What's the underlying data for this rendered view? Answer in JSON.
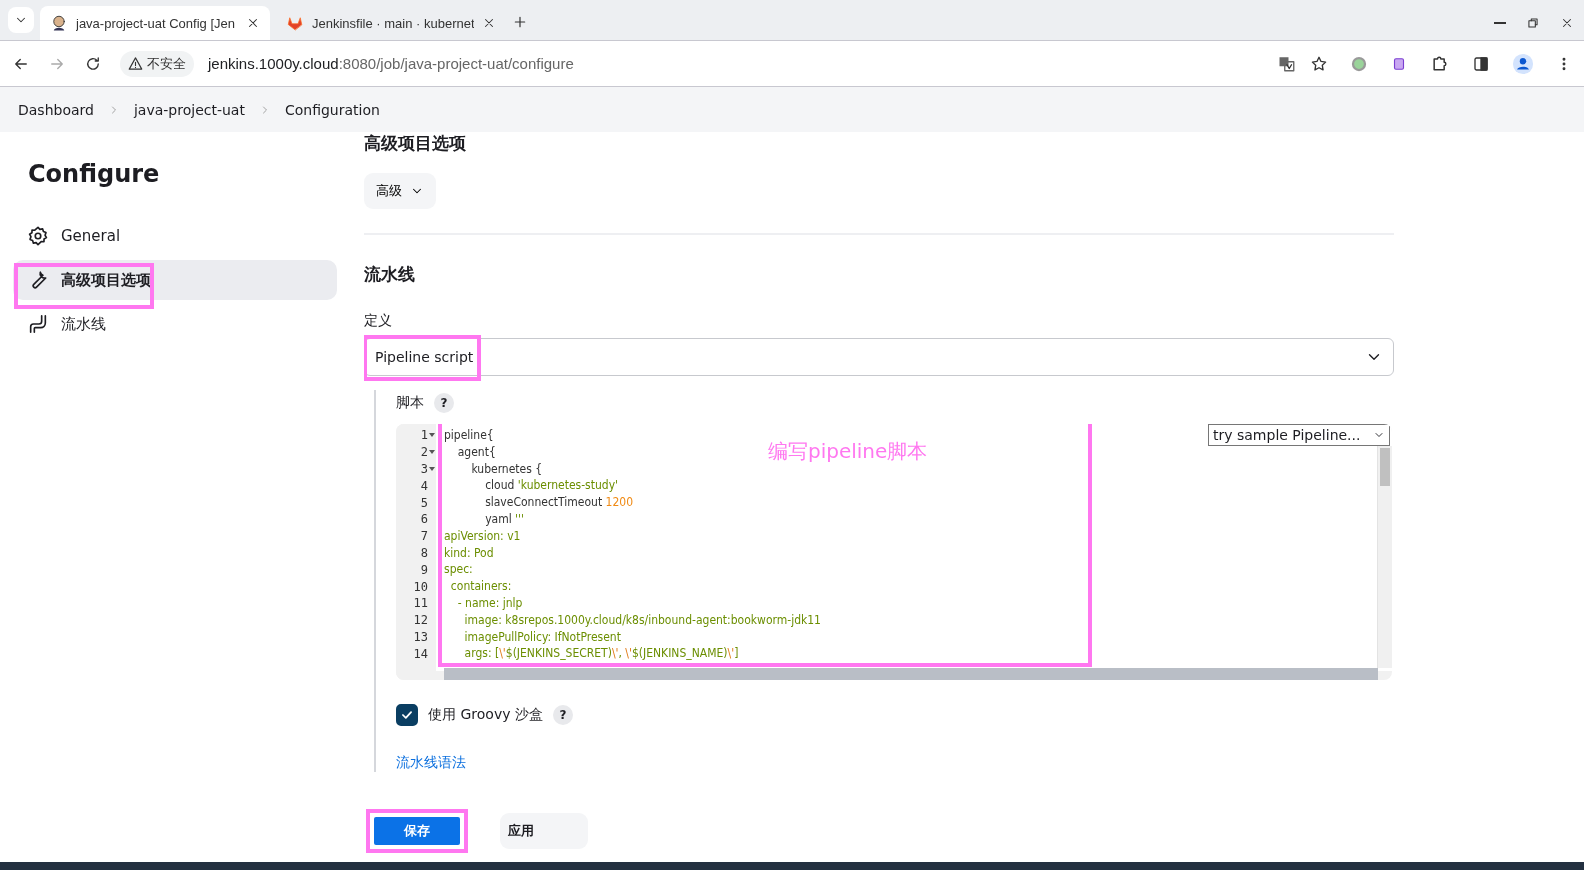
{
  "browser": {
    "tabs": [
      {
        "title": "java-project-uat Config [Jen",
        "selected": true
      },
      {
        "title": "Jenkinsfile · main · kubernet",
        "selected": false
      }
    ],
    "security": "不安全",
    "url_host": "jenkins.1000y.cloud",
    "url_path": ":8080/job/java-project-uat/configure"
  },
  "breadcrumbs": [
    "Dashboard",
    "java-project-uat",
    "Configuration"
  ],
  "sidebar": {
    "title": "Configure",
    "items": [
      {
        "label": "General",
        "selected": false
      },
      {
        "label": "高级项目选项",
        "selected": true
      },
      {
        "label": "流水线",
        "selected": false
      }
    ]
  },
  "advanced_section": {
    "heading": "高级项目选项",
    "button": "高级"
  },
  "pipeline_section": {
    "heading": "流水线",
    "definition_label": "定义",
    "definition_value": "Pipeline script",
    "script_label": "脚本",
    "help": "?",
    "sample_select": "try sample Pipeline...",
    "code": [
      {
        "number": "1",
        "fold": true,
        "tokens": [
          {
            "kind": "plain",
            "text": "pipeline{"
          }
        ]
      },
      {
        "number": "2",
        "fold": true,
        "tokens": [
          {
            "kind": "plain",
            "text": "    agent{"
          }
        ]
      },
      {
        "number": "3",
        "fold": true,
        "tokens": [
          {
            "kind": "plain",
            "text": "        kubernetes {"
          }
        ]
      },
      {
        "number": "4",
        "fold": false,
        "tokens": [
          {
            "kind": "plain",
            "text": "            cloud "
          },
          {
            "kind": "string",
            "text": "'kubernetes-study'"
          }
        ]
      },
      {
        "number": "5",
        "fold": false,
        "tokens": [
          {
            "kind": "plain",
            "text": "            slaveConnectTimeout "
          },
          {
            "kind": "number",
            "text": "1200"
          }
        ]
      },
      {
        "number": "6",
        "fold": false,
        "tokens": [
          {
            "kind": "plain",
            "text": "            yaml "
          },
          {
            "kind": "string",
            "text": "'''"
          }
        ]
      },
      {
        "number": "7",
        "fold": false,
        "tokens": [
          {
            "kind": "string",
            "text": "apiVersion: v1"
          }
        ]
      },
      {
        "number": "8",
        "fold": false,
        "tokens": [
          {
            "kind": "string",
            "text": "kind: Pod"
          }
        ]
      },
      {
        "number": "9",
        "fold": false,
        "tokens": [
          {
            "kind": "string",
            "text": "spec:"
          }
        ]
      },
      {
        "number": "10",
        "fold": false,
        "tokens": [
          {
            "kind": "string",
            "text": "  containers:"
          }
        ]
      },
      {
        "number": "11",
        "fold": false,
        "tokens": [
          {
            "kind": "string",
            "text": "    - name: jnlp"
          }
        ]
      },
      {
        "number": "12",
        "fold": false,
        "tokens": [
          {
            "kind": "string",
            "text": "      image: k8srepos.1000y.cloud/k8s/inbound-agent:bookworm-jdk11"
          }
        ]
      },
      {
        "number": "13",
        "fold": false,
        "tokens": [
          {
            "kind": "string",
            "text": "      imagePullPolicy: IfNotPresent"
          }
        ]
      },
      {
        "number": "14",
        "fold": false,
        "tokens": [
          {
            "kind": "string",
            "text": "      args: ["
          },
          {
            "kind": "escape",
            "text": "\\'"
          },
          {
            "kind": "string",
            "text": "$(JENKINS_SECRET)"
          },
          {
            "kind": "escape",
            "text": "\\'"
          },
          {
            "kind": "string",
            "text": ", "
          },
          {
            "kind": "escape",
            "text": "\\'"
          },
          {
            "kind": "string",
            "text": "$(JENKINS_NAME)"
          },
          {
            "kind": "escape",
            "text": "\\'"
          },
          {
            "kind": "string",
            "text": "]"
          }
        ]
      }
    ],
    "sandbox": {
      "label": "使用 Groovy 沙盒",
      "checked": true
    },
    "syntax_link": "流水线语法"
  },
  "buttons": [
    {
      "label": "保存",
      "kind": "primary"
    },
    {
      "label": "应用",
      "kind": "secondary"
    }
  ],
  "annotation": {
    "text": "编写pipeline脚本",
    "color": "#ff77f0"
  }
}
